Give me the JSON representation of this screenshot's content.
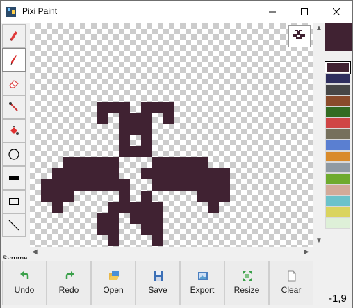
{
  "window": {
    "title": "Pixi Paint"
  },
  "tools": {
    "items": [
      {
        "name": "pencil"
      },
      {
        "name": "pen",
        "selected": true
      },
      {
        "name": "eraser"
      },
      {
        "name": "eyedropper"
      },
      {
        "name": "fill-bucket"
      },
      {
        "name": "circle"
      },
      {
        "name": "filled-rectangle"
      },
      {
        "name": "rectangle"
      },
      {
        "name": "line"
      }
    ],
    "cut_label": "Symme"
  },
  "palette": {
    "current_color": "#402232",
    "colors": [
      "#402232",
      "#2e2e5e",
      "#464646",
      "#8a4b2b",
      "#336b22",
      "#cf4545",
      "#76705c",
      "#5a7fd1",
      "#d98b2b",
      "#8f9aa3",
      "#6eaa2d",
      "#d2aa99",
      "#6cc2ca",
      "#dad45e",
      "#def0d8"
    ],
    "selected_index": 0
  },
  "buttons": {
    "undo": "Undo",
    "redo": "Redo",
    "open": "Open",
    "save": "Save",
    "export": "Export",
    "resize": "Resize",
    "clear": "Clear"
  },
  "status": {
    "coords": "-1,9"
  }
}
